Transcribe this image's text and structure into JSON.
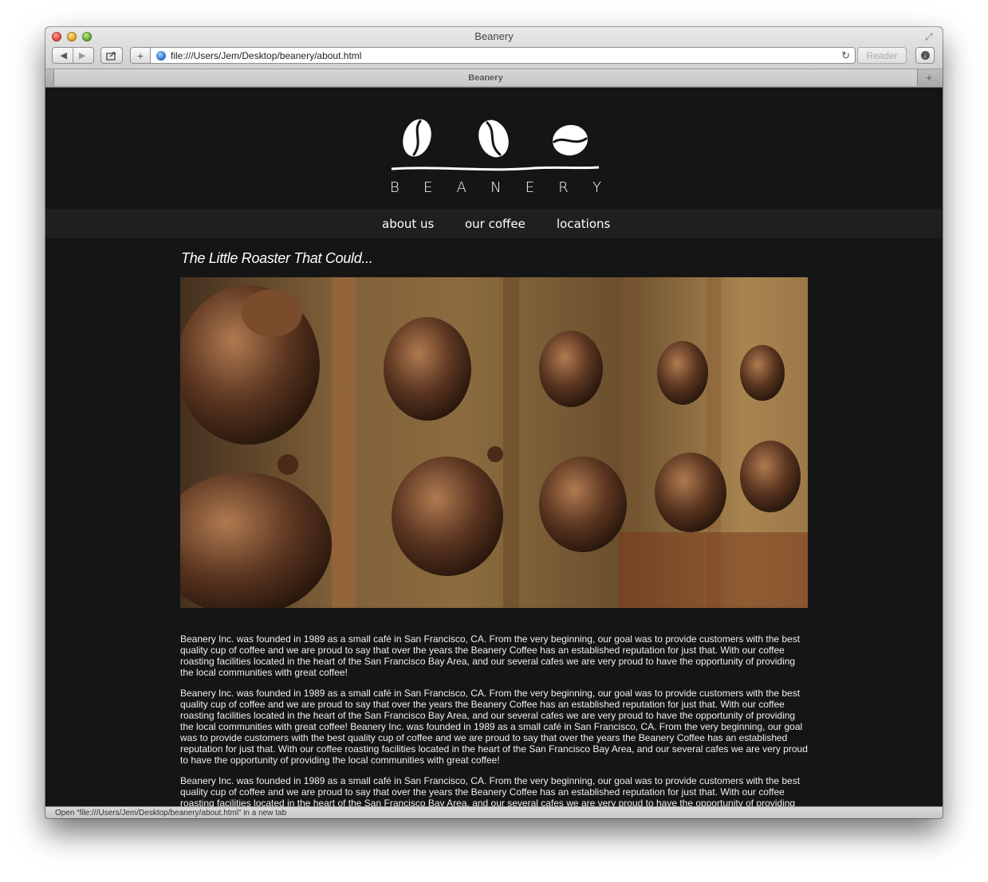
{
  "window": {
    "title": "Beanery",
    "url": "file:///Users/Jem/Desktop/beanery/about.html",
    "reader_label": "Reader",
    "tab_title": "Beanery",
    "status_text": "Open “file:///Users/Jem/Desktop/beanery/about.html” in a new tab"
  },
  "site": {
    "logo_letters": [
      "B",
      "E",
      "A",
      "N",
      "E",
      "R",
      "Y"
    ],
    "nav": [
      "about us",
      "our coffee",
      "locations"
    ],
    "heading": "The Little Roaster That Could...",
    "paragraphs": [
      "Beanery Inc. was founded in 1989 as a small café in San Francisco, CA. From the very beginning, our goal was to provide customers with the best quality cup of coffee and we are proud to say that over the years the Beanery Coffee has an established reputation for just that. With our coffee roasting facilities located in the heart of the San Francisco Bay Area, and our several cafes we are very proud to have the opportunity of providing the local communities with great coffee!",
      "Beanery Inc. was founded in 1989 as a small café in San Francisco, CA. From the very beginning, our goal was to provide customers with the best quality cup of coffee and we are proud to say that over the years the Beanery Coffee has an established reputation for just that. With our coffee roasting facilities located in the heart of the San Francisco Bay Area, and our several cafes we are very proud to have the opportunity of providing the local communities with great coffee! Beanery Inc. was founded in 1989 as a small café in San Francisco, CA. From the very beginning, our goal was to provide customers with the best quality cup of coffee and we are proud to say that over the years the Beanery Coffee has an established reputation for just that. With our coffee roasting facilities located in the heart of the San Francisco Bay Area, and our several cafes we are very proud to have the opportunity of providing the local communities with great coffee!",
      "Beanery Inc. was founded in 1989 as a small café in San Francisco, CA. From the very beginning, our goal was to provide customers with the best quality cup of coffee and we are proud to say that over the years the Beanery Coffee has an established reputation for just that. With our coffee roasting facilities located in the heart of the San Francisco Bay Area, and our several cafes we are very proud to have the opportunity of providing"
    ]
  },
  "colors": {
    "page_bg": "#151515",
    "nav_bg": "#1f1f1f",
    "text": "#ffffff"
  }
}
